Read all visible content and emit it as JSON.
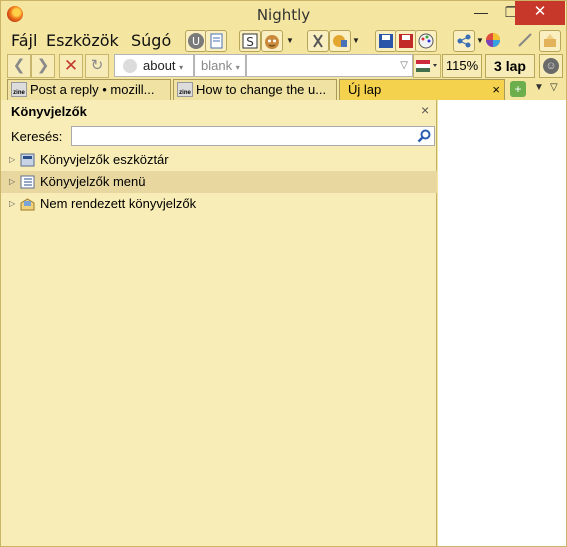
{
  "window": {
    "title": "Nightly",
    "minimize": "—",
    "maximize": "❐",
    "close": "✕"
  },
  "menu": [
    {
      "label": "Fájl"
    },
    {
      "label": "Eszközök"
    },
    {
      "label": "Súgó"
    }
  ],
  "nav": {
    "url_parts": [
      "about",
      "blank"
    ],
    "zoom": "115%",
    "tab_count": "3 lap"
  },
  "tabs": [
    {
      "label": "Post a reply • mozill...",
      "favicon": "zine",
      "active": false
    },
    {
      "label": "How to change the u...",
      "favicon": "zine",
      "active": false
    },
    {
      "label": "Új lap",
      "active": true,
      "close": "×"
    }
  ],
  "sidebar": {
    "title": "Könyvjelzők",
    "close": "×",
    "search_label": "Keresés:",
    "search_value": "",
    "items": [
      {
        "label": "Könyvjelzők eszköztár",
        "icon": "bookmark-toolbar-icon"
      },
      {
        "label": "Könyvjelzők menü",
        "icon": "bookmark-menu-icon"
      },
      {
        "label": "Nem rendezett könyvjelzők",
        "icon": "unsorted-bookmarks-icon"
      }
    ]
  }
}
